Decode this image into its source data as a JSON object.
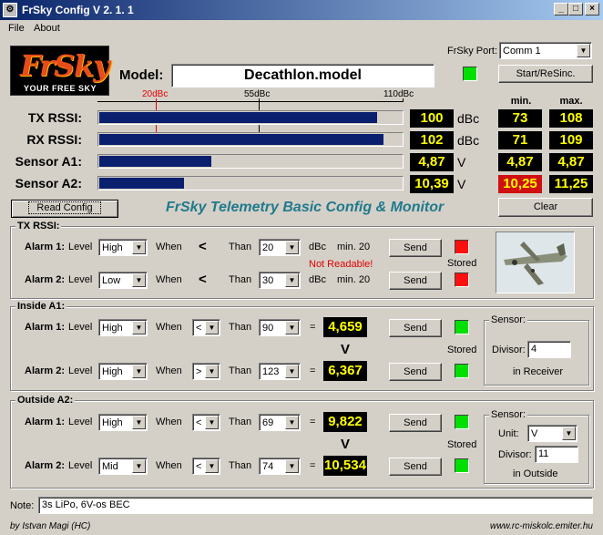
{
  "window": {
    "title": "FrSky Config V 2. 1. 1",
    "minimize": "_",
    "maximize": "□",
    "close": "×"
  },
  "menu": {
    "file": "File",
    "about": "About"
  },
  "logo": {
    "brand": "FrSky",
    "tagline": "YOUR FREE SKY"
  },
  "model": {
    "label": "Model:",
    "value": "Decathlon.model"
  },
  "port": {
    "label": "FrSky Port:",
    "value": "Comm  1",
    "button": "Start/ReSinc."
  },
  "scale": {
    "min": "20dBc",
    "mid": "55dBc",
    "max": "110dBc"
  },
  "columns": {
    "min": "min.",
    "max": "max."
  },
  "meters": [
    {
      "label": "TX RSSI:",
      "value": "100",
      "unit": "dBc",
      "min": "73",
      "max": "108",
      "fill": 0.92
    },
    {
      "label": "RX RSSI:",
      "value": "102",
      "unit": "dBc",
      "min": "71",
      "max": "109",
      "fill": 0.94
    },
    {
      "label": "Sensor A1:",
      "value": "4,87",
      "unit": "V",
      "min": "4,87",
      "max": "4,87",
      "fill": 0.37
    },
    {
      "label": "Sensor A2:",
      "value": "10,39",
      "unit": "V",
      "min": "10,25",
      "max": "11,25",
      "fill": 0.28
    }
  ],
  "buttons": {
    "read_config": "Read Config",
    "clear": "Clear",
    "send": "Send"
  },
  "heading": "FrSky Telemetry Basic Config & Monitor",
  "common": {
    "level": "Level",
    "when": "When",
    "than": "Than",
    "stored": "Stored",
    "alarm1": "Alarm 1:",
    "alarm2": "Alarm 2:",
    "eq": "="
  },
  "tx_rssi": {
    "title": "TX RSSI:",
    "alarm1": {
      "level": "High",
      "op": "<",
      "than": "20",
      "unit": "dBc",
      "min": "min. 20"
    },
    "alarm2": {
      "level": "Low",
      "op": "<",
      "than": "30",
      "unit": "dBc",
      "min": "min. 20"
    },
    "warning": "Not Readable!"
  },
  "inside_a1": {
    "title": "Inside A1:",
    "alarm1": {
      "level": "High",
      "op": "<",
      "than": "90",
      "calc": "4,659"
    },
    "alarm2": {
      "level": "High",
      "op": ">",
      "than": "123",
      "calc": "6,367"
    },
    "unit": "V",
    "sensor": {
      "title": "Sensor:",
      "divisor_label": "Divisor:",
      "divisor": "4",
      "location": "in Receiver"
    }
  },
  "outside_a2": {
    "title": "Outside A2:",
    "alarm1": {
      "level": "High",
      "op": "<",
      "than": "69",
      "calc": "9,822"
    },
    "alarm2": {
      "level": "Mid",
      "op": "<",
      "than": "74",
      "calc": "10,534"
    },
    "unit": "V",
    "sensor": {
      "title": "Sensor:",
      "unit_label": "Unit:",
      "unit": "V",
      "divisor_label": "Divisor:",
      "divisor": "11",
      "location": "in Outside"
    }
  },
  "note": {
    "label": "Note:",
    "value": "3s LiPo, 6V-os BEC"
  },
  "status": {
    "author": "by Istvan Magi    (HC)",
    "url": "www.rc-miskolc.emiter.hu"
  }
}
